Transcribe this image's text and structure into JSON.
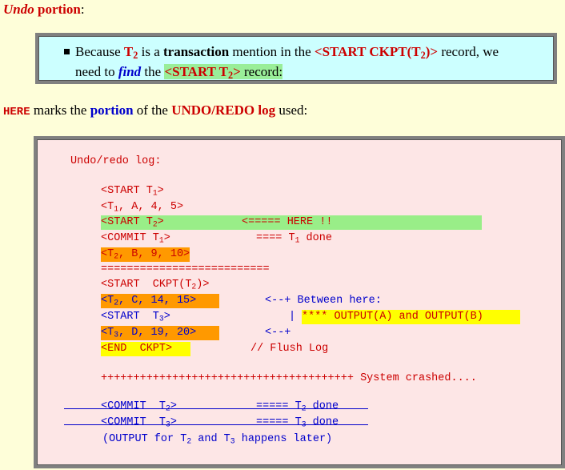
{
  "heading": {
    "undo": "Undo",
    "portion": "portion",
    "colon": ":"
  },
  "bullet_box": {
    "because": "Because",
    "t": "T",
    "t_sub": "2",
    "is_a": "is a",
    "transaction": "transaction",
    "mention": "mention in the",
    "start_ckpt": "<START CKPT(T",
    "start_ckpt_sub": "2",
    "start_ckpt_end": ")>",
    "record_we": "record, we",
    "need_to": "need to",
    "find": "find",
    "the": "the",
    "start_t2": "<START T",
    "start_t2_sub": "2",
    "start_t2_end": ">",
    "record": "record:"
  },
  "here_line": {
    "here": "HERE",
    "marks_the": "marks the",
    "portion": "portion",
    "of_the": "of the",
    "log_name": "UNDO/REDO log",
    "used": "used:"
  },
  "log": {
    "title": "Undo/redo log:",
    "lines": {
      "start_t1": {
        "a": "<START T",
        "sub": "1",
        "b": ">"
      },
      "t1_rec": {
        "a": "<T",
        "sub": "1",
        "b": ", A, 4, 5>"
      },
      "start_t2": {
        "a": "<START T",
        "sub": "2",
        "b": ">"
      },
      "here_arrow": "<===== HERE !!",
      "commit_t1": {
        "a": "<COMMIT T",
        "sub": "1",
        "b": ">"
      },
      "t1_done": {
        "a": "==== T",
        "sub": "1",
        "b": " done"
      },
      "t2_rec": {
        "a": "<T",
        "sub": "2",
        "b": ", B, 9, 10>"
      },
      "separator": "==========================",
      "start_ckpt": {
        "a": "<START  CKPT(T",
        "sub": "2",
        "b": ")>"
      },
      "t2_rec2": {
        "a": "<T",
        "sub": "2",
        "b": ", C, 14, 15>"
      },
      "between": "<--+ Between here:",
      "start_t3": {
        "a": "<START  T",
        "sub": "3",
        "b": ">"
      },
      "pipe": "|",
      "output_note": "**** OUTPUT(A) and OUTPUT(B)",
      "t3_rec": {
        "a": "<T",
        "sub": "3",
        "b": ", D, 19, 20>"
      },
      "arrow_end": "<--+",
      "end_ckpt": "<END  CKPT>",
      "flush": "// Flush Log",
      "crash_plus": "+++++++++++++++++++++++++++++++++++++++",
      "crash_text": "System crashed....",
      "commit_t2": {
        "a": "<COMMIT  T",
        "sub": "2",
        "b": ">"
      },
      "t2_done": {
        "a": "===== T",
        "sub": "2",
        "b": " done"
      },
      "commit_t3": {
        "a": "<COMMIT  T",
        "sub": "3",
        "b": ">"
      },
      "t3_done": {
        "a": "===== T",
        "sub": "3",
        "b": " done"
      },
      "output_later": {
        "a": "(OUTPUT for T",
        "sub1": "2",
        "b": " and T",
        "sub2": "3",
        "c": " happens later)"
      }
    }
  }
}
